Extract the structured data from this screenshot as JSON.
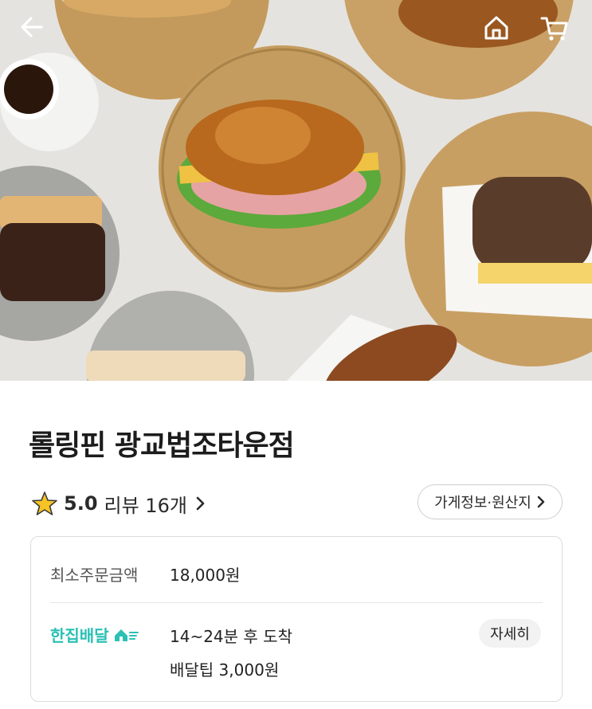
{
  "store": {
    "name": "롤링핀 광교법조타운점"
  },
  "rating": {
    "value": "5.0",
    "review_label": "리뷰 16개"
  },
  "info_button": {
    "label": "가게정보·원산지"
  },
  "card": {
    "min_order_label": "최소주문금액",
    "min_order_value": "18,000원",
    "delivery_brand": "한집배달",
    "delivery_time": "14~24분 후 도착",
    "delivery_tip": "배달팁 3,000원",
    "detail_button": "자세히"
  },
  "colors": {
    "accent_teal": "#2bc0b4",
    "star": "#f7c325"
  },
  "icons": {
    "back": "arrow-left-icon",
    "home": "home-icon",
    "cart": "cart-icon",
    "star": "star-icon",
    "chevron": "chevron-right-icon",
    "delivery": "delivery-house-icon"
  }
}
